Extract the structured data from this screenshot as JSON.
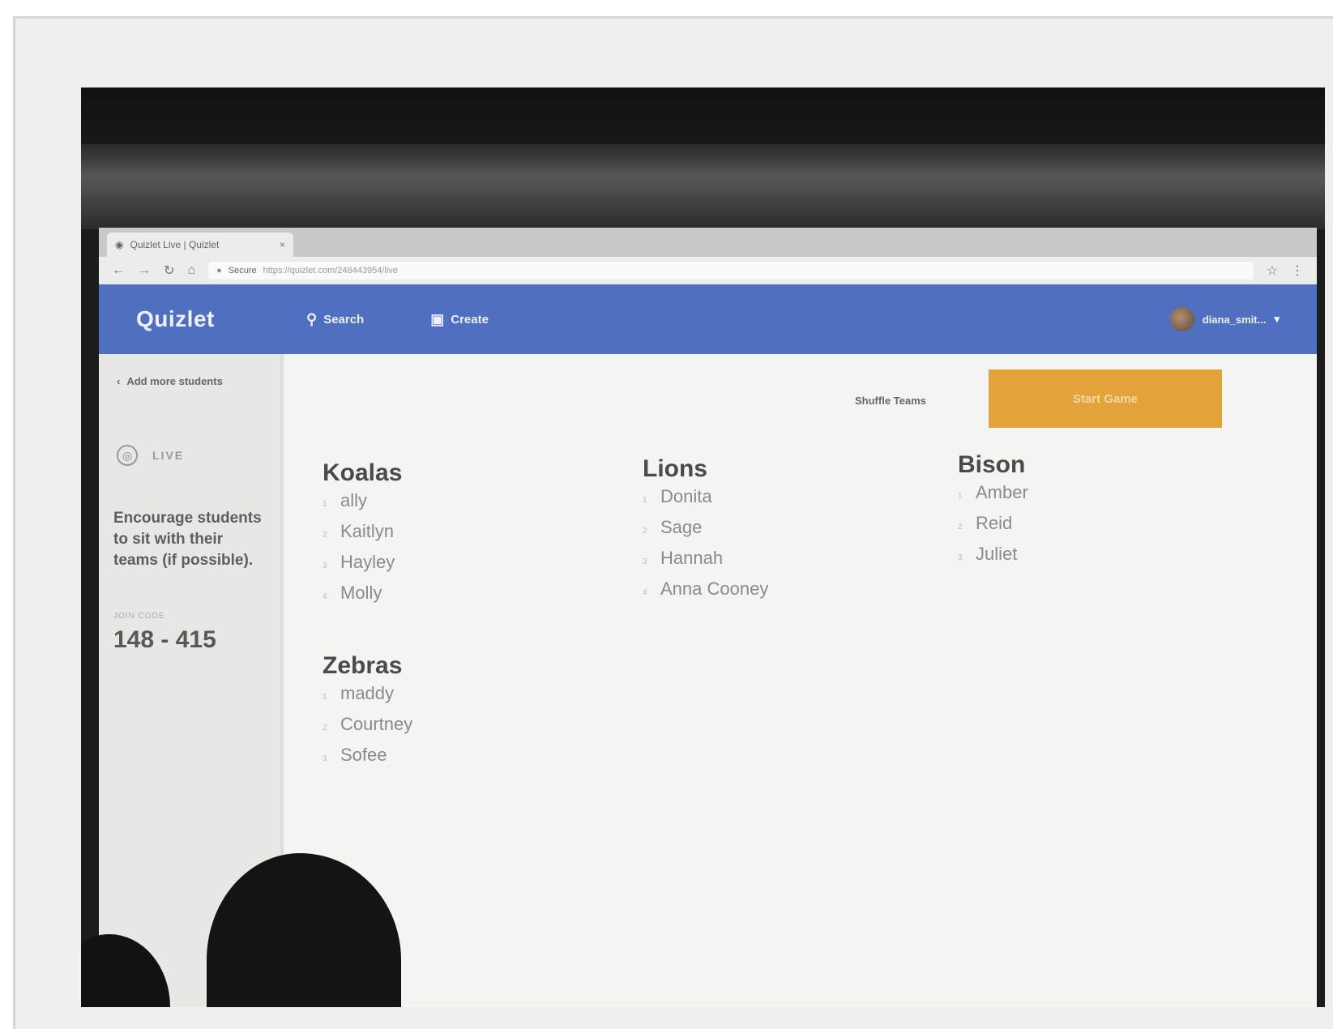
{
  "browser": {
    "tab_title": "Quizlet Live | Quizlet",
    "tab_close": "×",
    "url_secure": "Secure",
    "url": "https://quizlet.com/248443954/live"
  },
  "header": {
    "logo": "Quizlet",
    "search_label": "Search",
    "create_label": "Create",
    "username": "diana_smit...",
    "user_caret": "▾"
  },
  "sidebar": {
    "back_label": "Add more students",
    "live_label": "LIVE",
    "instructions": "Encourage students to sit with their teams (if possible).",
    "join_label": "JOIN CODE",
    "join_code": "148 - 415"
  },
  "toolbar": {
    "shuffle_label": "Shuffle Teams",
    "start_label": "Start Game"
  },
  "teams": [
    {
      "name": "Koalas",
      "members": [
        "ally",
        "Kaitlyn",
        "Hayley",
        "Molly"
      ]
    },
    {
      "name": "Zebras",
      "members": [
        "maddy",
        "Courtney",
        "Sofee"
      ]
    },
    {
      "name": "Lions",
      "members": [
        "Donita",
        "Sage",
        "Hannah",
        "Anna Cooney"
      ]
    },
    {
      "name": "Bison",
      "members": [
        "Amber",
        "Reid",
        "Juliet"
      ]
    }
  ],
  "icons": {
    "search": "search-icon",
    "create": "create-icon",
    "back": "chevron-left-icon",
    "live": "live-icon"
  },
  "colors": {
    "header_blue": "#4f6fc1",
    "start_orange": "#e3a33b"
  }
}
